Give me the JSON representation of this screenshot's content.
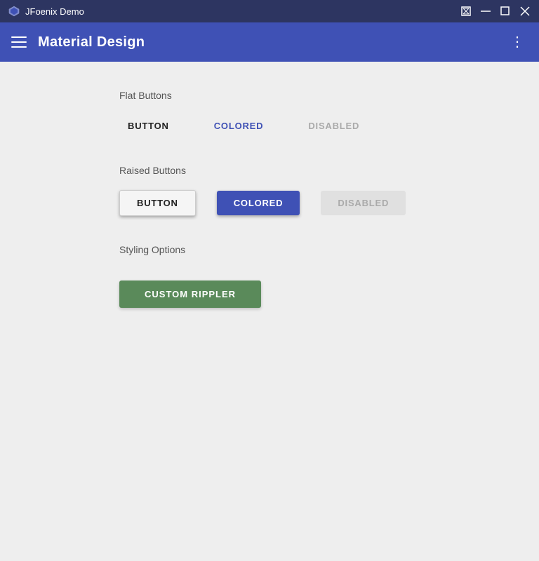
{
  "titleBar": {
    "title": "JFoenix Demo",
    "controls": {
      "maximize": "⛶",
      "minimize": "—",
      "restore": "☐",
      "close": "✕"
    }
  },
  "appBar": {
    "title": "Material Design",
    "moreIcon": "⋮"
  },
  "content": {
    "flatButtons": {
      "sectionLabel": "Flat Buttons",
      "buttons": [
        {
          "label": "BUTTON",
          "type": "default"
        },
        {
          "label": "COLORED",
          "type": "colored"
        },
        {
          "label": "DISABLED",
          "type": "disabled"
        }
      ]
    },
    "raisedButtons": {
      "sectionLabel": "Raised Buttons",
      "buttons": [
        {
          "label": "BUTTON",
          "type": "default"
        },
        {
          "label": "COLORED",
          "type": "colored"
        },
        {
          "label": "DISABLED",
          "type": "disabled"
        }
      ]
    },
    "stylingOptions": {
      "sectionLabel": "Styling Options",
      "customRipplerLabel": "CUSTOM RIPPLER"
    }
  }
}
